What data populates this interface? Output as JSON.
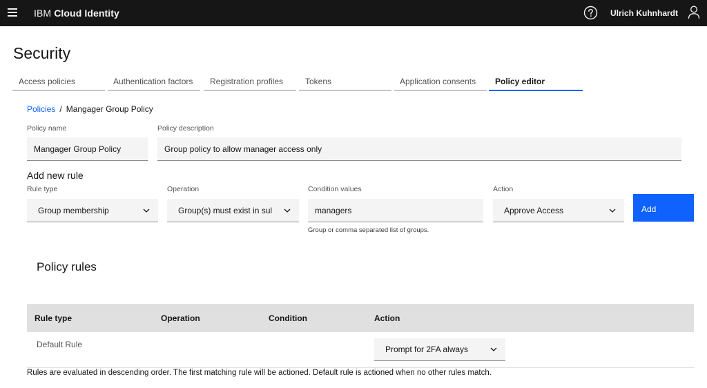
{
  "header": {
    "brand_ibm": "IBM",
    "brand_product": "Cloud Identity",
    "username": "Ulrich Kuhnhardt",
    "icons": {
      "menu": "hamburger-menu-icon",
      "help": "help-icon",
      "user": "user-icon"
    }
  },
  "page": {
    "title": "Security"
  },
  "tabs": [
    {
      "label": "Access policies",
      "active": false
    },
    {
      "label": "Authentication factors",
      "active": false
    },
    {
      "label": "Registration profiles",
      "active": false
    },
    {
      "label": "Tokens",
      "active": false
    },
    {
      "label": "Application consents",
      "active": false
    },
    {
      "label": "Policy editor",
      "active": true
    }
  ],
  "breadcrumb": {
    "link": "Policies",
    "separator": "/",
    "current": "Mangager Group Policy"
  },
  "policy": {
    "name_label": "Policy name",
    "name_value": "Mangager Group Policy",
    "description_label": "Policy description",
    "description_value": "Group policy to allow manager access only"
  },
  "add_rule": {
    "title": "Add new rule",
    "rule_type_label": "Rule type",
    "rule_type_value": "Group membership",
    "operation_label": "Operation",
    "operation_value": "Group(s) must exist in sul",
    "condition_label": "Condition values",
    "condition_value": "managers",
    "condition_helper": "Group or comma separated list of groups.",
    "action_label": "Action",
    "action_value": "Approve Access",
    "add_button": "Add"
  },
  "rules": {
    "title": "Policy rules",
    "columns": [
      "Rule type",
      "Operation",
      "Condition",
      "Action"
    ],
    "rows": [
      {
        "rule_type": "Default Rule",
        "operation": "",
        "condition": "",
        "action": "Prompt for 2FA always"
      }
    ],
    "footnote": "Rules are evaluated in descending order. The first matching rule will be actioned. Default rule is actioned when no other rules match."
  },
  "colors": {
    "topbar": "#161616",
    "accent": "#0f62fe",
    "field_bg": "#f4f4f4",
    "table_header_bg": "#e0e0e0"
  }
}
